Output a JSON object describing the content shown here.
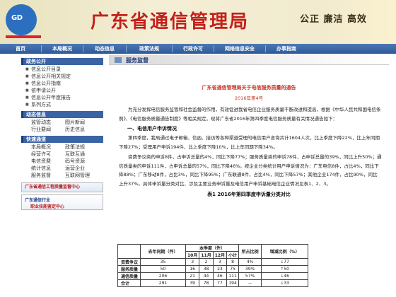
{
  "header": {
    "logo_text": "GD",
    "title": "广东省通信管理局",
    "slogan": "公正  廉洁  高效"
  },
  "nav": {
    "items": [
      "首页",
      "本局概况",
      "动态信息",
      "政策法规",
      "行政许可",
      "网络信息安全",
      "办事指南"
    ]
  },
  "sidebar": {
    "gov_open": {
      "heading": "政务公开",
      "items": [
        "信息公开目录",
        "信息公开相关规定",
        "信息公开指南",
        "依申请公开",
        "信息公开年度报告",
        "系列方式"
      ]
    },
    "news": {
      "heading": "动态信息",
      "items": [
        "监管动态",
        "图片新闻",
        "行业要闻",
        "历史信息"
      ]
    },
    "quick": {
      "heading": "快速通道",
      "items": [
        "本局概况",
        "政策法规",
        "经营许可",
        "互联互通",
        "电信资费",
        "码号资源",
        "统计信息",
        "运营企业",
        "服务监督",
        "互联网管理"
      ]
    },
    "banner1": "广东省通信工程质量监督中心",
    "banner2_title": "广东通信行业",
    "banner2_sub": "职业技能鉴定中心"
  },
  "main": {
    "section_title": "服务监督",
    "article_title": "广东省通信管理局关于电信服务质量的通告",
    "article_no": "2016年第4号",
    "intro": "为充分发挥电信服务监管和社会监督的作用，有效促进我省电信企业服务质量不断改进和提高，根据《中华人民共和国电信条例》、《电信服务质量通告制度》等相关规定，现将广东省2016年第四季度电信服务质量有关情况通告如下：",
    "sub_title": "一、电信用户申诉情况",
    "para1": "第四季度，我局通过电子邮箱、信函、接访等各种渠道受理的电信用户咨询共计1604人次，比上季度下降22%，比上年同期下降27%；受理用户申诉194件，比上季度下降10%，比上年同期下降34%。",
    "para2": "资费争议类的申诉8件，占申诉总量的4%，同比下降77%；服务质量类的申诉78件，占申诉总量的39%，同比上升50%；通信质量类的申诉111件，占申诉总量的57%，同比下降46%。按企业分类统计用户申诉情况为：广东电信8件，占比4%，同比下降88%；广东移动8件，占比3%，同比下降95%；广东联通8件，占比4%，同比下降57%；其他企业174件，占比90%，同比上升37%。具体申诉量分类对比、涉及主要业务申诉量及电信用户申诉基础电信企业情况见表1、2、3。"
  },
  "table": {
    "caption": "表1    2016年第四季度申诉量分类对比",
    "col_last_year": "去年同期（件）",
    "col_this_q": "本季度（件）",
    "months": [
      "10月",
      "11月",
      "12月",
      "小计"
    ],
    "col_share": "所占比例",
    "col_growth": "增减比例（%）",
    "rows": [
      {
        "name": "资费争议",
        "last": "35",
        "m10": "3",
        "m11": "2",
        "m12": "3",
        "sub": "8",
        "share": "4%",
        "growth": "77",
        "dir": "down"
      },
      {
        "name": "服务质量",
        "last": "50",
        "m10": "16",
        "m11": "38",
        "m12": "23",
        "sub": "75",
        "share": "39%",
        "growth": "50",
        "dir": "up"
      },
      {
        "name": "通信质量",
        "last": "206",
        "m10": "21",
        "m11": "44",
        "m12": "46",
        "sub": "111",
        "share": "57%",
        "growth": "46",
        "dir": "down"
      },
      {
        "name": "合计",
        "last": "291",
        "m10": "39",
        "m11": "78",
        "m12": "77",
        "sub": "194",
        "share": "－",
        "growth": "33",
        "dir": "down"
      }
    ],
    "arrow_up": "↑",
    "arrow_down": "↓"
  }
}
